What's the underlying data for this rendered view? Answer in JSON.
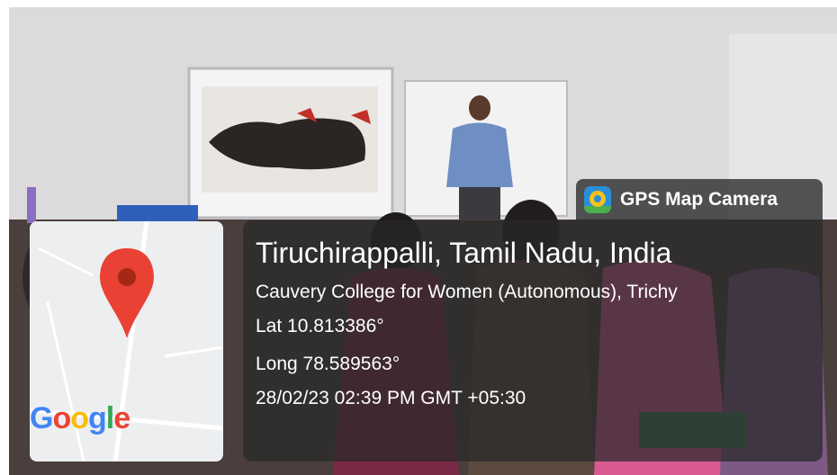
{
  "badge": {
    "app_name": "GPS Map Camera",
    "icon": "gps-map-camera-icon"
  },
  "location": {
    "place": "Tiruchirappalli, Tamil Nadu, India",
    "address": "Cauvery College for Women (Autonomous), Trichy",
    "lat": "Lat 10.813386°",
    "long": "Long 78.589563°",
    "datetime": "28/02/23 02:39 PM GMT +05:30"
  },
  "map": {
    "pin_icon": "map-pin-icon",
    "logo": "Google",
    "colors": {
      "pin": "#e94235",
      "pin_dot": "#a52714",
      "g_blue": "#4285f4",
      "g_red": "#ea4335",
      "g_yellow": "#fbbc05",
      "g_green": "#34a853"
    }
  }
}
